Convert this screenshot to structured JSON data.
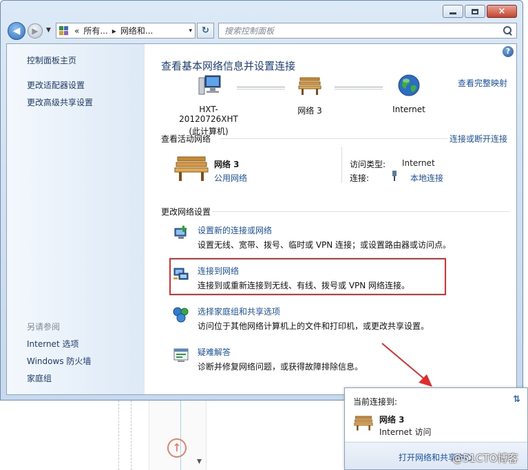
{
  "window": {
    "minimize": "minimize",
    "maximize": "maximize",
    "close": "×"
  },
  "toolbar": {
    "back": "◀",
    "forward": "▶",
    "breadcrumb": [
      "«",
      "所有...",
      "▸",
      "网络和...",
      "▾"
    ],
    "refresh": "↻",
    "search_placeholder": "搜索控制面板"
  },
  "sidebar": {
    "links": [
      "控制面板主页",
      "更改适配器设置",
      "更改高级共享设置"
    ],
    "see_also_heading": "另请参阅",
    "see_also": [
      "Internet 选项",
      "Windows 防火墙",
      "家庭组"
    ]
  },
  "main": {
    "title": "查看基本网络信息并设置连接",
    "full_map_link": "查看完整映射",
    "nodes": [
      {
        "label": "HXT-20120726XHT",
        "sub": "(此计算机)"
      },
      {
        "label": "网络  3",
        "sub": ""
      },
      {
        "label": "Internet",
        "sub": ""
      }
    ],
    "active_heading": "查看活动网络",
    "connect_disconnect": "连接或断开连接",
    "active_network": {
      "name": "网络  3",
      "type": "公用网络",
      "access_type_label": "访问类型:",
      "access_type_value": "Internet",
      "connection_label": "连接:",
      "connection_value": "本地连接"
    },
    "change_heading": "更改网络设置",
    "tasks": [
      {
        "title": "设置新的连接或网络",
        "desc": "设置无线、宽带、拨号、临时或 VPN 连接；或设置路由器或访问点。"
      },
      {
        "title": "连接到网络",
        "desc": "连接到或重新连接到无线、有线、拨号或 VPN 网络连接。"
      },
      {
        "title": "选择家庭组和共享选项",
        "desc": "访问位于其他网络计算机上的文件和打印机，或更改共享设置。"
      },
      {
        "title": "疑难解答",
        "desc": "诊断并修复网络问题，或获得故障排除信息。"
      }
    ]
  },
  "flyout": {
    "heading": "当前连接到:",
    "network": "网络  3",
    "access": "Internet 访问",
    "open_link": "打开网络和共享中心"
  },
  "watermark": "@51CTO博客",
  "colors": {
    "highlight_box": "#e32b2b",
    "link": "#1a52a8",
    "title": "#1a3e82"
  }
}
